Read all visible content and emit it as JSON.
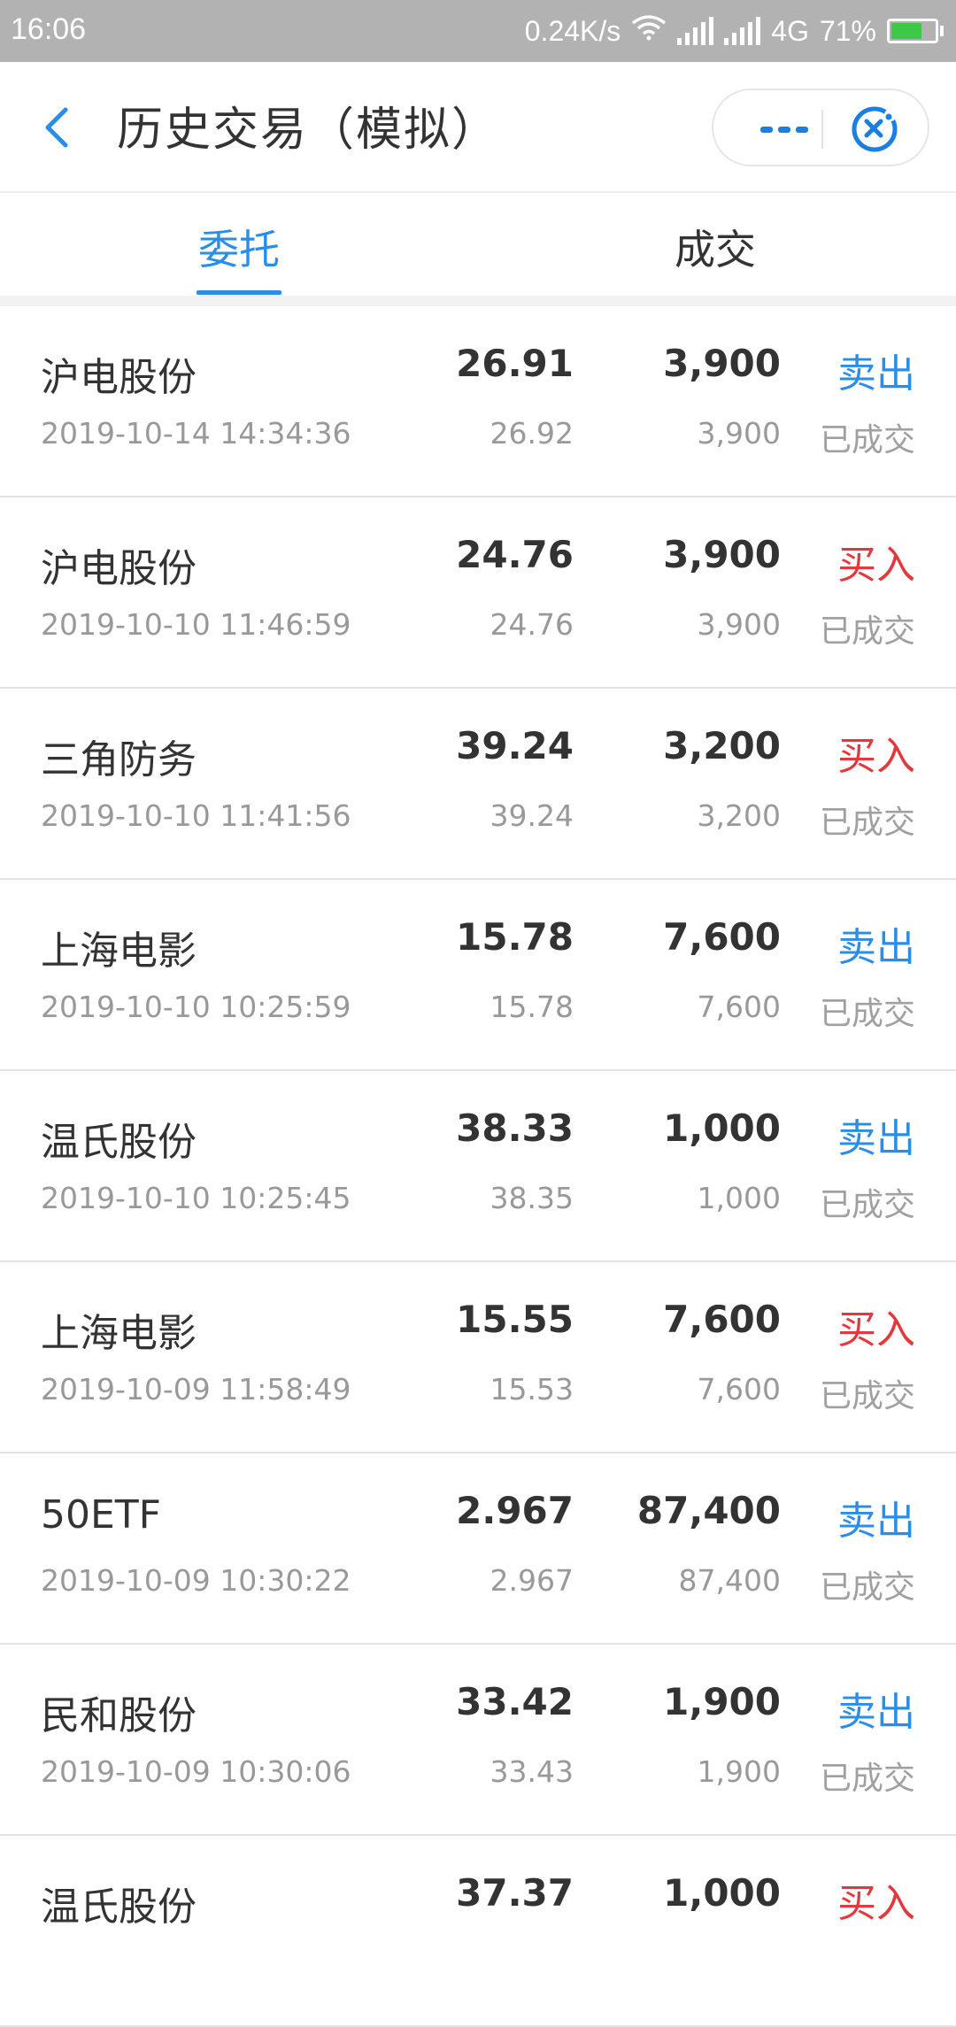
{
  "status_bar": {
    "time": "16:06",
    "speed": "0.24K/s",
    "network": "4G",
    "battery": "71%",
    "battery_level": 0.71,
    "battery_color": "#3ec84a"
  },
  "header": {
    "title": "历史交易（模拟）",
    "back_icon": "chevron-left-icon",
    "more_icon": "more-dots-icon",
    "close_icon": "close-circle-icon"
  },
  "tabs": [
    {
      "label": "委托",
      "active": true
    },
    {
      "label": "成交",
      "active": false
    }
  ],
  "colors": {
    "accent": "#2a8ee8",
    "sell": "#2a8ee8",
    "buy": "#e4393c"
  },
  "orders": [
    {
      "name": "沪电股份",
      "datetime": "2019-10-14  14:34:36",
      "price": "26.91",
      "deal_price": "26.92",
      "qty": "3,900",
      "deal_qty": "3,900",
      "side": "卖出",
      "side_type": "sell",
      "status": "已成交"
    },
    {
      "name": "沪电股份",
      "datetime": "2019-10-10  11:46:59",
      "price": "24.76",
      "deal_price": "24.76",
      "qty": "3,900",
      "deal_qty": "3,900",
      "side": "买入",
      "side_type": "buy",
      "status": "已成交"
    },
    {
      "name": "三角防务",
      "datetime": "2019-10-10  11:41:56",
      "price": "39.24",
      "deal_price": "39.24",
      "qty": "3,200",
      "deal_qty": "3,200",
      "side": "买入",
      "side_type": "buy",
      "status": "已成交"
    },
    {
      "name": "上海电影",
      "datetime": "2019-10-10  10:25:59",
      "price": "15.78",
      "deal_price": "15.78",
      "qty": "7,600",
      "deal_qty": "7,600",
      "side": "卖出",
      "side_type": "sell",
      "status": "已成交"
    },
    {
      "name": "温氏股份",
      "datetime": "2019-10-10  10:25:45",
      "price": "38.33",
      "deal_price": "38.35",
      "qty": "1,000",
      "deal_qty": "1,000",
      "side": "卖出",
      "side_type": "sell",
      "status": "已成交"
    },
    {
      "name": "上海电影",
      "datetime": "2019-10-09  11:58:49",
      "price": "15.55",
      "deal_price": "15.53",
      "qty": "7,600",
      "deal_qty": "7,600",
      "side": "买入",
      "side_type": "buy",
      "status": "已成交"
    },
    {
      "name": "50ETF",
      "datetime": "2019-10-09  10:30:22",
      "price": "2.967",
      "deal_price": "2.967",
      "qty": "87,400",
      "deal_qty": "87,400",
      "side": "卖出",
      "side_type": "sell",
      "status": "已成交"
    },
    {
      "name": "民和股份",
      "datetime": "2019-10-09  10:30:06",
      "price": "33.42",
      "deal_price": "33.43",
      "qty": "1,900",
      "deal_qty": "1,900",
      "side": "卖出",
      "side_type": "sell",
      "status": "已成交"
    },
    {
      "name": "温氏股份",
      "datetime": "",
      "price": "37.37",
      "deal_price": "",
      "qty": "1,000",
      "deal_qty": "",
      "side": "买入",
      "side_type": "buy",
      "status": ""
    }
  ]
}
